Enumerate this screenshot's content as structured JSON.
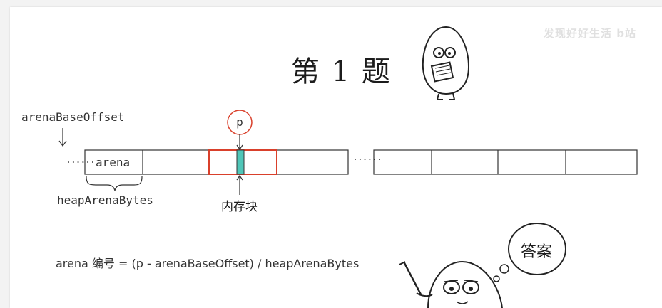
{
  "title": "第 1 题",
  "watermark": "发现好好生活 b站",
  "labels": {
    "arena_base_offset": "arenaBaseOffset",
    "arena": "arena",
    "heap_arena_bytes": "heapArenaBytes",
    "pointer": "p",
    "memory_block": "内存块",
    "ellipsis_left": "......",
    "ellipsis_mid": "......"
  },
  "formula": "arena 编号 = (p - arenaBaseOffset) / heapArenaBytes",
  "answer_bubble": "答案",
  "colors": {
    "highlight_border": "#d9402b",
    "memory_block_fill": "#4fc6b8",
    "pointer_circle": "#d9402b"
  }
}
